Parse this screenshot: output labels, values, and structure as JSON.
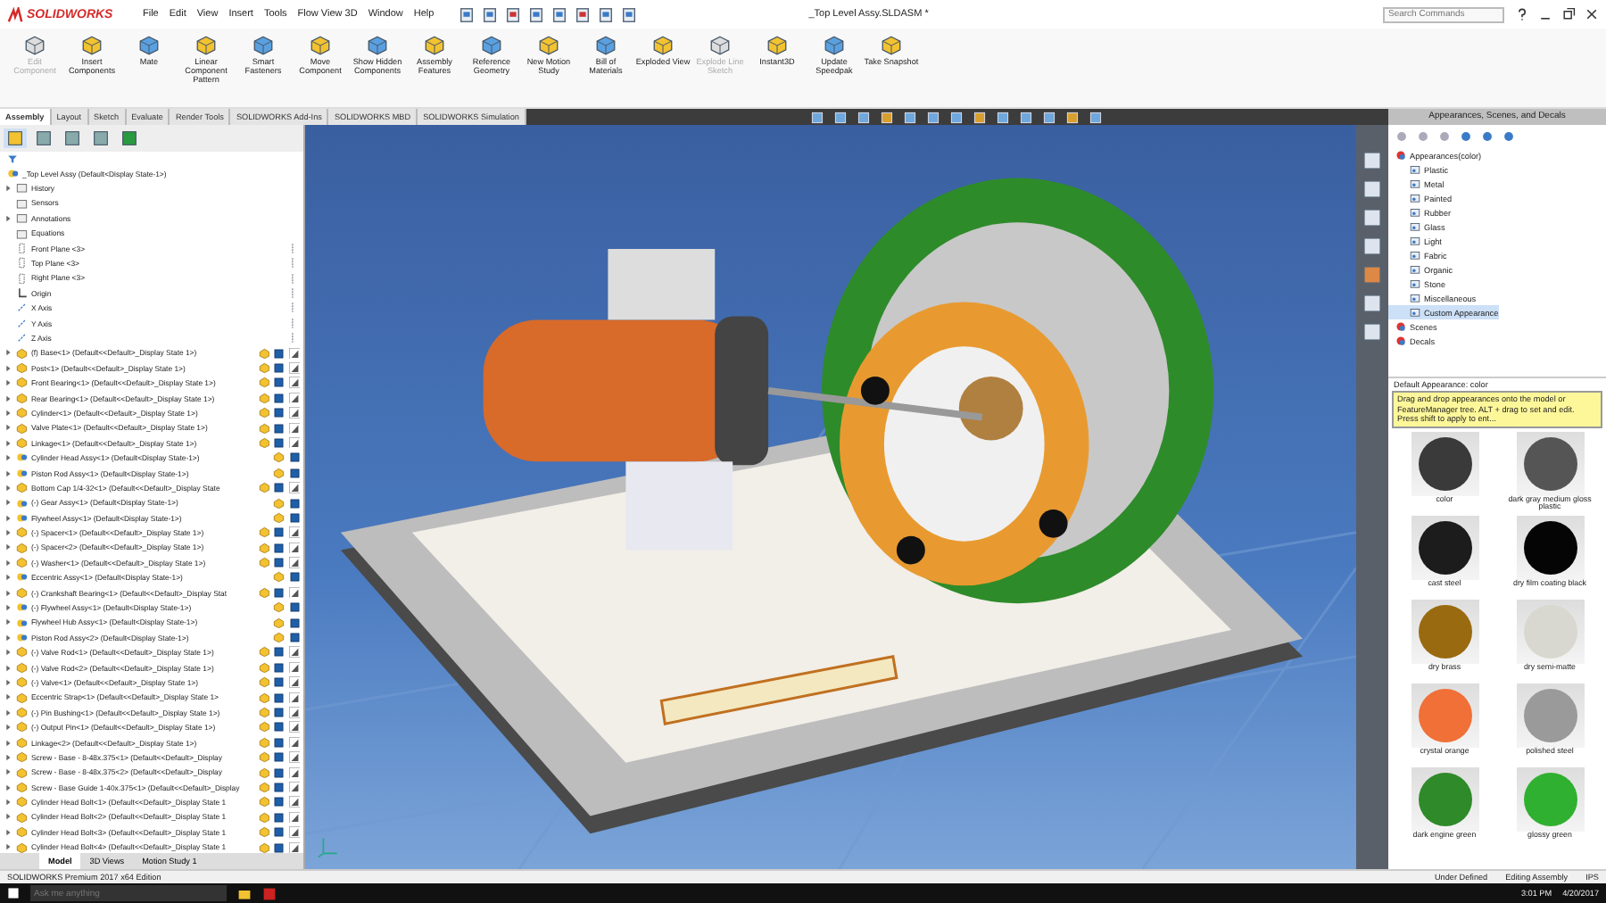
{
  "app": {
    "logo": "SOLIDWORKS",
    "menu": [
      "File",
      "Edit",
      "View",
      "Insert",
      "Tools",
      "Flow View 3D",
      "Window",
      "Help"
    ],
    "title": "_Top Level Assy.SLDASM *",
    "search": {
      "placeholder": "Search Commands"
    }
  },
  "ribbon": [
    {
      "label": "Edit Component",
      "disabled": true
    },
    {
      "label": "Insert Components",
      "disabled": false
    },
    {
      "label": "Mate",
      "disabled": false
    },
    {
      "label": "Linear Component Pattern",
      "disabled": false
    },
    {
      "label": "Smart Fasteners",
      "disabled": false
    },
    {
      "label": "Move Component",
      "disabled": false
    },
    {
      "label": "Show Hidden Components",
      "disabled": false
    },
    {
      "label": "Assembly Features",
      "disabled": false
    },
    {
      "label": "Reference Geometry",
      "disabled": false
    },
    {
      "label": "New Motion Study",
      "disabled": false
    },
    {
      "label": "Bill of Materials",
      "disabled": false
    },
    {
      "label": "Exploded View",
      "disabled": false
    },
    {
      "label": "Explode Line Sketch",
      "disabled": true
    },
    {
      "label": "Instant3D",
      "disabled": false
    },
    {
      "label": "Update Speedpak",
      "disabled": false
    },
    {
      "label": "Take Snapshot",
      "disabled": false
    }
  ],
  "tabs": [
    {
      "label": "Assembly",
      "selected": true
    },
    {
      "label": "Layout",
      "selected": false
    },
    {
      "label": "Sketch",
      "selected": false
    },
    {
      "label": "Evaluate",
      "selected": false
    },
    {
      "label": "Render Tools",
      "selected": false
    },
    {
      "label": "SOLIDWORKS Add-Ins",
      "selected": false
    },
    {
      "label": "SOLIDWORKS MBD",
      "selected": false
    },
    {
      "label": "SOLIDWORKS Simulation",
      "selected": false
    }
  ],
  "tree": {
    "root": "_Top Level Assy (Default<Display State-1>)",
    "items": [
      {
        "label": "History",
        "kind": "folder",
        "expandable": true
      },
      {
        "label": "Sensors",
        "kind": "folder",
        "expandable": false
      },
      {
        "label": "Annotations",
        "kind": "folder",
        "expandable": true
      },
      {
        "label": "Equations",
        "kind": "folder",
        "expandable": false
      },
      {
        "label": "Front Plane <3>",
        "kind": "plane",
        "expandable": false
      },
      {
        "label": "Top Plane <3>",
        "kind": "plane",
        "expandable": false
      },
      {
        "label": "Right Plane <3>",
        "kind": "plane",
        "expandable": false
      },
      {
        "label": "Origin",
        "kind": "origin",
        "expandable": false
      },
      {
        "label": "X Axis",
        "kind": "axis",
        "expandable": false
      },
      {
        "label": "Y Axis",
        "kind": "axis",
        "expandable": false
      },
      {
        "label": "Z Axis",
        "kind": "axis",
        "expandable": false
      },
      {
        "label": "(f) Base<1> (Default<<Default>_Display State 1>)",
        "kind": "part",
        "expandable": true
      },
      {
        "label": "Post<1> (Default<<Default>_Display State 1>)",
        "kind": "part",
        "expandable": true
      },
      {
        "label": "Front Bearing<1> (Default<<Default>_Display State 1>)",
        "kind": "part",
        "expandable": true
      },
      {
        "label": "Rear Bearing<1> (Default<<Default>_Display State 1>)",
        "kind": "part",
        "expandable": true
      },
      {
        "label": "Cylinder<1> (Default<<Default>_Display State 1>)",
        "kind": "part",
        "expandable": true
      },
      {
        "label": "Valve Plate<1> (Default<<Default>_Display State 1>)",
        "kind": "part",
        "expandable": true
      },
      {
        "label": "Linkage<1> (Default<<Default>_Display State 1>)",
        "kind": "part",
        "expandable": true
      },
      {
        "label": "Cylinder Head Assy<1> (Default<Display State-1>)",
        "kind": "assembly",
        "expandable": true
      },
      {
        "label": "Piston Rod Assy<1> (Default<Display State-1>)",
        "kind": "assembly",
        "expandable": true
      },
      {
        "label": "Bottom Cap 1/4-32<1> (Default<<Default>_Display State",
        "kind": "part",
        "expandable": true
      },
      {
        "label": "(-) Gear Assy<1> (Default<Display State-1>)",
        "kind": "assembly",
        "expandable": true
      },
      {
        "label": "Flywheel Assy<1> (Default<Display State-1>)",
        "kind": "assembly",
        "expandable": true
      },
      {
        "label": "(-) Spacer<1> (Default<<Default>_Display State 1>)",
        "kind": "part",
        "expandable": true
      },
      {
        "label": "(-) Spacer<2> (Default<<Default>_Display State 1>)",
        "kind": "part",
        "expandable": true
      },
      {
        "label": "(-) Washer<1> (Default<<Default>_Display State 1>)",
        "kind": "part",
        "expandable": true
      },
      {
        "label": "Eccentric Assy<1> (Default<Display State-1>)",
        "kind": "assembly",
        "expandable": true
      },
      {
        "label": "(-) Crankshaft Bearing<1> (Default<<Default>_Display Stat",
        "kind": "part",
        "expandable": true
      },
      {
        "label": "(-) Flywheel Assy<1> (Default<Display State-1>)",
        "kind": "assembly",
        "expandable": true
      },
      {
        "label": "Flywheel Hub Assy<1> (Default<Display State-1>)",
        "kind": "assembly",
        "expandable": true
      },
      {
        "label": "Piston Rod Assy<2> (Default<Display State-1>)",
        "kind": "assembly",
        "expandable": true
      },
      {
        "label": "(-) Valve Rod<1> (Default<<Default>_Display State 1>)",
        "kind": "part",
        "expandable": true
      },
      {
        "label": "(-) Valve Rod<2> (Default<<Default>_Display State 1>)",
        "kind": "part",
        "expandable": true
      },
      {
        "label": "(-) Valve<1> (Default<<Default>_Display State 1>)",
        "kind": "part",
        "expandable": true
      },
      {
        "label": "Eccentric Strap<1> (Default<<Default>_Display State 1>",
        "kind": "part",
        "expandable": true
      },
      {
        "label": "(-) Pin Bushing<1> (Default<<Default>_Display State 1>)",
        "kind": "part",
        "expandable": true
      },
      {
        "label": "(-) Output Pin<1> (Default<<Default>_Display State 1>)",
        "kind": "part",
        "expandable": true
      },
      {
        "label": "Linkage<2> (Default<<Default>_Display State 1>)",
        "kind": "part",
        "expandable": true
      },
      {
        "label": "Screw - Base - 8-48x.375<1> (Default<<Default>_Display",
        "kind": "part",
        "expandable": true
      },
      {
        "label": "Screw - Base - 8-48x.375<2> (Default<<Default>_Display",
        "kind": "part",
        "expandable": true
      },
      {
        "label": "Screw - Base Guide 1-40x.375<1> (Default<<Default>_Display",
        "kind": "part",
        "expandable": true
      },
      {
        "label": "Cylinder Head Bolt<1> (Default<<Default>_Display State 1",
        "kind": "part",
        "expandable": true
      },
      {
        "label": "Cylinder Head Bolt<2> (Default<<Default>_Display State 1",
        "kind": "part",
        "expandable": true
      },
      {
        "label": "Cylinder Head Bolt<3> (Default<<Default>_Display State 1",
        "kind": "part",
        "expandable": true
      },
      {
        "label": "Cylinder Head Bolt<4> (Default<<Default>_Display State 1",
        "kind": "part",
        "expandable": true
      }
    ]
  },
  "model_tabs": [
    {
      "label": "Model",
      "selected": true
    },
    {
      "label": "3D Views",
      "selected": false
    },
    {
      "label": "Motion Study 1",
      "selected": false
    }
  ],
  "task_pane": {
    "title": "Appearances, Scenes, and Decals",
    "tree": [
      {
        "label": "Appearances(color)",
        "selected": false,
        "children": [
          {
            "label": "Plastic",
            "selected": false
          },
          {
            "label": "Metal",
            "selected": false
          },
          {
            "label": "Painted",
            "selected": false
          },
          {
            "label": "Rubber",
            "selected": false
          },
          {
            "label": "Glass",
            "selected": false
          },
          {
            "label": "Light",
            "selected": false
          },
          {
            "label": "Fabric",
            "selected": false
          },
          {
            "label": "Organic",
            "selected": false
          },
          {
            "label": "Stone",
            "selected": false
          },
          {
            "label": "Miscellaneous",
            "selected": false
          },
          {
            "label": "Custom Appearance",
            "selected": true
          }
        ]
      },
      {
        "label": "Scenes",
        "selected": false
      },
      {
        "label": "Decals",
        "selected": false
      }
    ],
    "section": "Default Appearance: color",
    "tooltip": "Drag and drop appearances onto the model or FeatureManager tree. ALT + drag to set and edit. Press shift to apply to ent...",
    "swatches": [
      {
        "label": "color",
        "color": "#3a3a3a"
      },
      {
        "label": "dark gray medium gloss plastic",
        "color": "#555555"
      },
      {
        "label": "cast steel",
        "color": "#1c1c1c"
      },
      {
        "label": "dry film coating black",
        "color": "#050505"
      },
      {
        "label": "dry brass",
        "color": "#9a6a10"
      },
      {
        "label": "dry semi-matte",
        "color": "#d8d8d0"
      },
      {
        "label": "crystal orange",
        "color": "#f07038"
      },
      {
        "label": "polished steel",
        "color": "#9a9a9a"
      },
      {
        "label": "dark engine green",
        "color": "#2f8a2a"
      },
      {
        "label": "glossy green",
        "color": "#30b030"
      }
    ]
  },
  "status": {
    "product": "SOLIDWORKS Premium 2017 x64 Edition",
    "state": "Under Defined",
    "mode": "Editing Assembly",
    "units": "IPS"
  },
  "taskbar": {
    "search": {
      "placeholder": "Ask me anything"
    },
    "time": "3:01 PM",
    "date": "4/20/2017"
  }
}
